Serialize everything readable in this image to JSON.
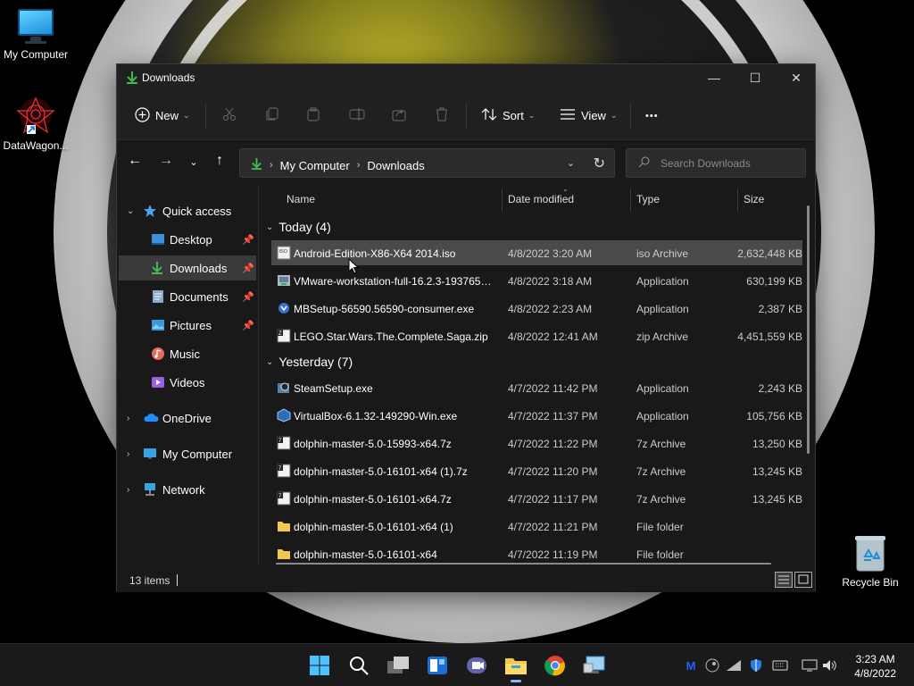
{
  "desktop": {
    "icons": [
      {
        "label": "My Computer"
      },
      {
        "label": "DataWagon..."
      },
      {
        "label": "Recycle Bin"
      }
    ]
  },
  "window": {
    "title": "Downloads",
    "controls": {
      "minimize": "—",
      "maximize": "☐",
      "close": "✕"
    }
  },
  "toolbar": {
    "new_label": "New",
    "sort_label": "Sort",
    "view_label": "View",
    "more_label": "•••"
  },
  "navbar": {
    "breadcrumb": [
      "My Computer",
      "Downloads"
    ],
    "search_placeholder": "Search Downloads"
  },
  "sidebar": {
    "items": [
      {
        "label": "Quick access"
      },
      {
        "label": "Desktop"
      },
      {
        "label": "Downloads"
      },
      {
        "label": "Documents"
      },
      {
        "label": "Pictures"
      },
      {
        "label": "Music"
      },
      {
        "label": "Videos"
      },
      {
        "label": "OneDrive"
      },
      {
        "label": "My Computer"
      },
      {
        "label": "Network"
      }
    ]
  },
  "columns": {
    "name": "Name",
    "date": "Date modified",
    "type": "Type",
    "size": "Size"
  },
  "groups": [
    {
      "label": "Today (4)",
      "files": [
        {
          "name": "Android-Edition-X86-X64 2014.iso",
          "date": "4/8/2022 3:20 AM",
          "type": "iso Archive",
          "size": "2,632,448 KB",
          "icon": "iso-icon"
        },
        {
          "name": "VMware-workstation-full-16.2.3-1937653...",
          "date": "4/8/2022 3:18 AM",
          "type": "Application",
          "size": "630,199 KB",
          "icon": "installer-icon"
        },
        {
          "name": "MBSetup-56590.56590-consumer.exe",
          "date": "4/8/2022 2:23 AM",
          "type": "Application",
          "size": "2,387 KB",
          "icon": "installer-icon"
        },
        {
          "name": "LEGO.Star.Wars.The.Complete.Saga.zip",
          "date": "4/8/2022 12:41 AM",
          "type": "zip Archive",
          "size": "4,451,559 KB",
          "icon": "archive-icon"
        }
      ]
    },
    {
      "label": "Yesterday (7)",
      "files": [
        {
          "name": "SteamSetup.exe",
          "date": "4/7/2022 11:42 PM",
          "type": "Application",
          "size": "2,243 KB",
          "icon": "installer-icon"
        },
        {
          "name": "VirtualBox-6.1.32-149290-Win.exe",
          "date": "4/7/2022 11:37 PM",
          "type": "Application",
          "size": "105,756 KB",
          "icon": "installer-icon"
        },
        {
          "name": "dolphin-master-5.0-15993-x64.7z",
          "date": "4/7/2022 11:22 PM",
          "type": "7z Archive",
          "size": "13,250 KB",
          "icon": "archive-icon"
        },
        {
          "name": "dolphin-master-5.0-16101-x64 (1).7z",
          "date": "4/7/2022 11:20 PM",
          "type": "7z Archive",
          "size": "13,245 KB",
          "icon": "archive-icon"
        },
        {
          "name": "dolphin-master-5.0-16101-x64.7z",
          "date": "4/7/2022 11:17 PM",
          "type": "7z Archive",
          "size": "13,245 KB",
          "icon": "archive-icon"
        },
        {
          "name": "dolphin-master-5.0-16101-x64 (1)",
          "date": "4/7/2022 11:21 PM",
          "type": "File folder",
          "size": "",
          "icon": "folder-icon"
        },
        {
          "name": "dolphin-master-5.0-16101-x64",
          "date": "4/7/2022 11:19 PM",
          "type": "File folder",
          "size": "",
          "icon": "folder-icon"
        }
      ]
    }
  ],
  "status": {
    "item_count": "13 items"
  },
  "clock": {
    "time": "3:23 AM",
    "date": "4/8/2022"
  },
  "colors": {
    "accent": "#60cdff",
    "download_green": "#3fb950",
    "folder_yellow": "#f2c94c"
  }
}
